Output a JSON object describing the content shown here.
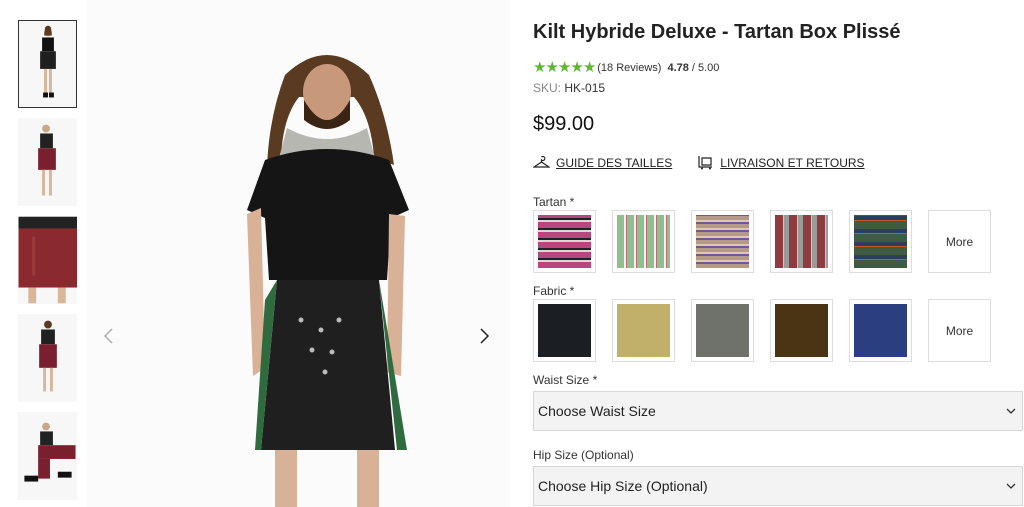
{
  "product": {
    "title": "Kilt Hybride Deluxe - Tartan Box Plissé",
    "rating": {
      "stars": 4.78,
      "reviews_text": "(18 Reviews)",
      "score": "4.78",
      "out_of": "/ 5.00"
    },
    "sku_label": "SKU:",
    "sku_value": "HK-015",
    "price": "$99.00"
  },
  "links": {
    "size_guide": "GUIDE DES TAILLES",
    "shipping": "LIVRAISON ET RETOURS"
  },
  "tartan": {
    "label": "Tartan *",
    "more_label": "More",
    "swatch_colors": [
      "#b9467f",
      "#8fbf8c",
      "#b59b86",
      "#8e3c3f",
      "#3f5c42"
    ]
  },
  "fabric": {
    "label": "Fabric *",
    "more_label": "More",
    "swatch_colors": [
      "#1b1e22",
      "#c0b069",
      "#6f716b",
      "#4a3414",
      "#2b3f80"
    ]
  },
  "waist": {
    "label": "Waist Size *",
    "value": "Choose Waist Size"
  },
  "hip": {
    "label": "Hip Size (Optional)",
    "value": "Choose Hip Size (Optional)"
  },
  "colors": {
    "star": "#5cb82e",
    "kilt": "#1f1f1f",
    "kilt_alt": "#7a1f2e"
  },
  "gallery": {
    "thumbnail_count": 5,
    "active_index": 0
  }
}
